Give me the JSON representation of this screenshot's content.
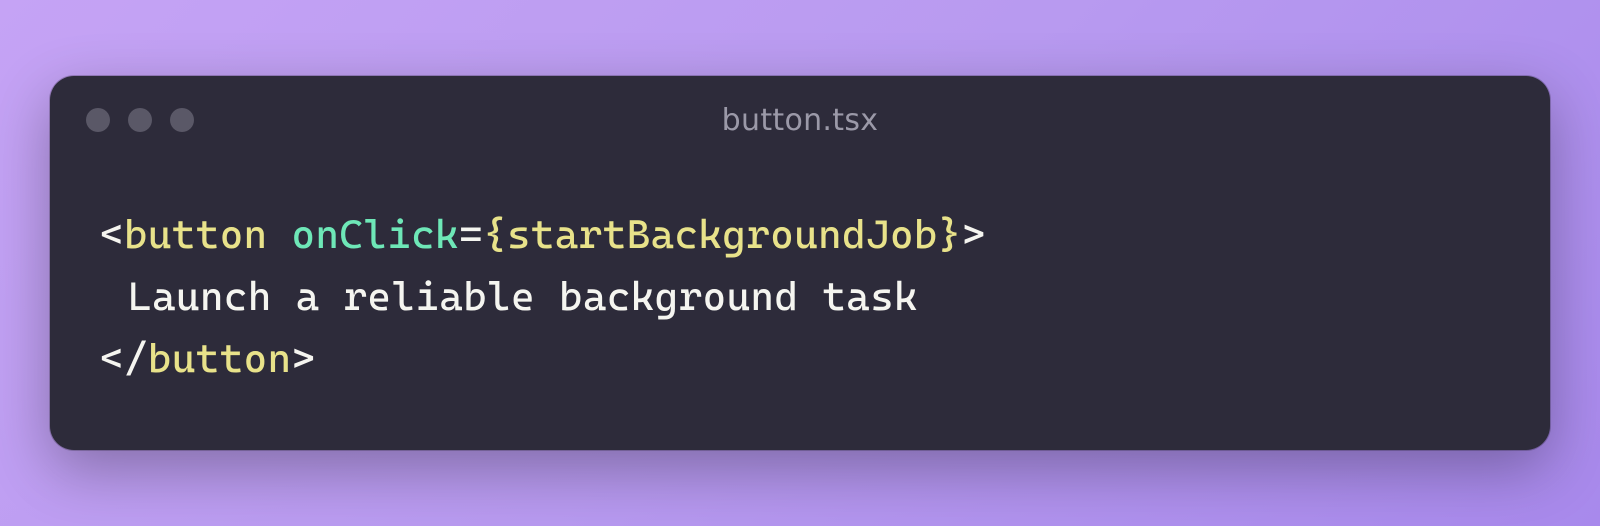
{
  "window": {
    "filename": "button.tsx"
  },
  "code": {
    "line1": {
      "open_bracket": "<",
      "tag": "button",
      "space": " ",
      "attr": "onClick",
      "equals": "=",
      "brace_open": "{",
      "expr": "startBackgroundJob",
      "brace_close": "}",
      "close_bracket": ">"
    },
    "line2": {
      "text": "Launch a reliable background task"
    },
    "line3": {
      "open_bracket": "</",
      "tag": "button",
      "close_bracket": ">"
    }
  }
}
